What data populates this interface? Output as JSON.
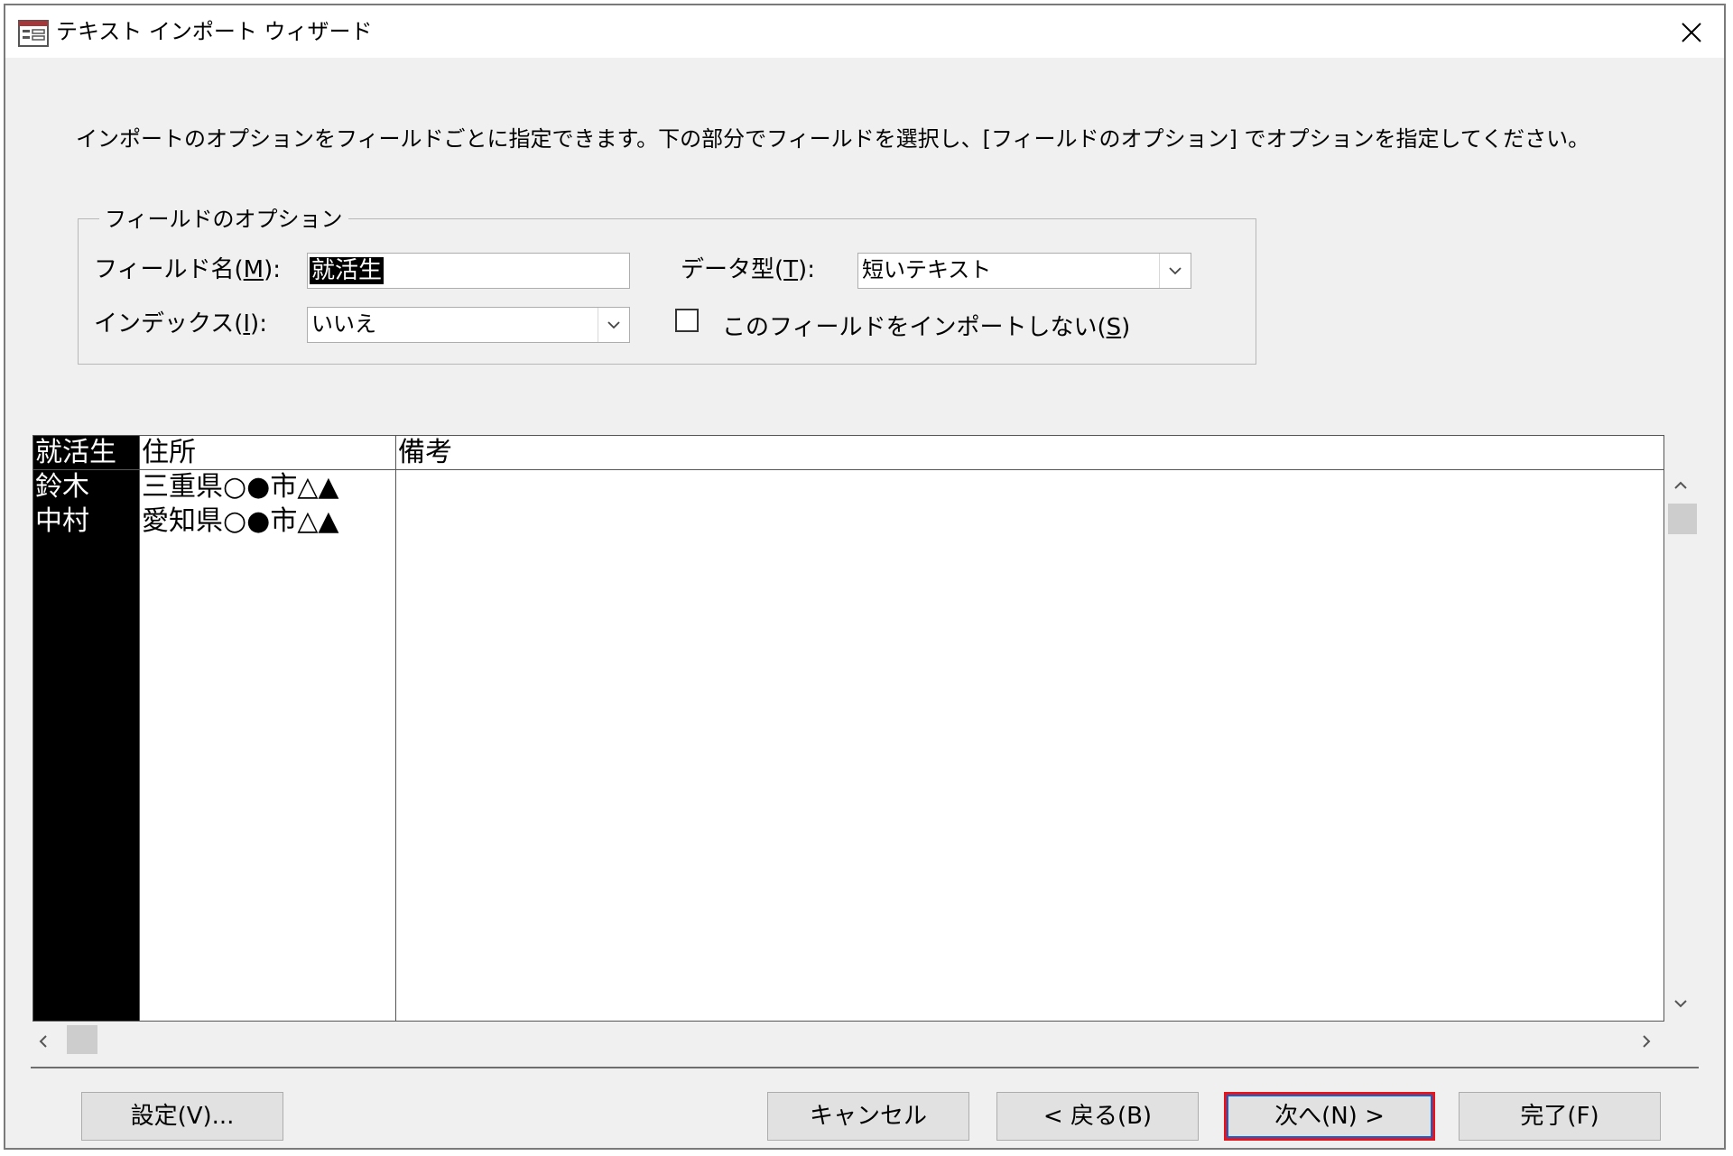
{
  "window": {
    "title": "テキスト インポート ウィザード",
    "close_glyph": "✕"
  },
  "instruction": "インポートのオプションをフィールドごとに指定できます。下の部分でフィールドを選択し、[フィールドのオプション] でオプションを指定してください。",
  "field_options": {
    "legend": "フィールドのオプション",
    "field_name_label": "フィールド名(",
    "field_name_key": "M",
    "field_name_suffix": "):",
    "field_name_value": "就活生",
    "data_type_label": "データ型(",
    "data_type_key": "T",
    "data_type_suffix": "):",
    "data_type_value": "短いテキスト",
    "index_label": "インデックス(",
    "index_key": "I",
    "index_suffix": "):",
    "index_value": "いいえ",
    "skip_label": "このフィールドをインポートしない(",
    "skip_key": "S",
    "skip_suffix": ")",
    "skip_checked": false
  },
  "grid": {
    "columns": [
      "就活生",
      "住所",
      "備考"
    ],
    "rows": [
      [
        "鈴木",
        "三重県○●市△▲",
        ""
      ],
      [
        "中村",
        "愛知県○●市△▲",
        ""
      ]
    ]
  },
  "buttons": {
    "settings": "設定(V)...",
    "cancel": "キャンセル",
    "back": "< 戻る(B)",
    "next": "次へ(N) >",
    "finish": "完了(F)"
  }
}
